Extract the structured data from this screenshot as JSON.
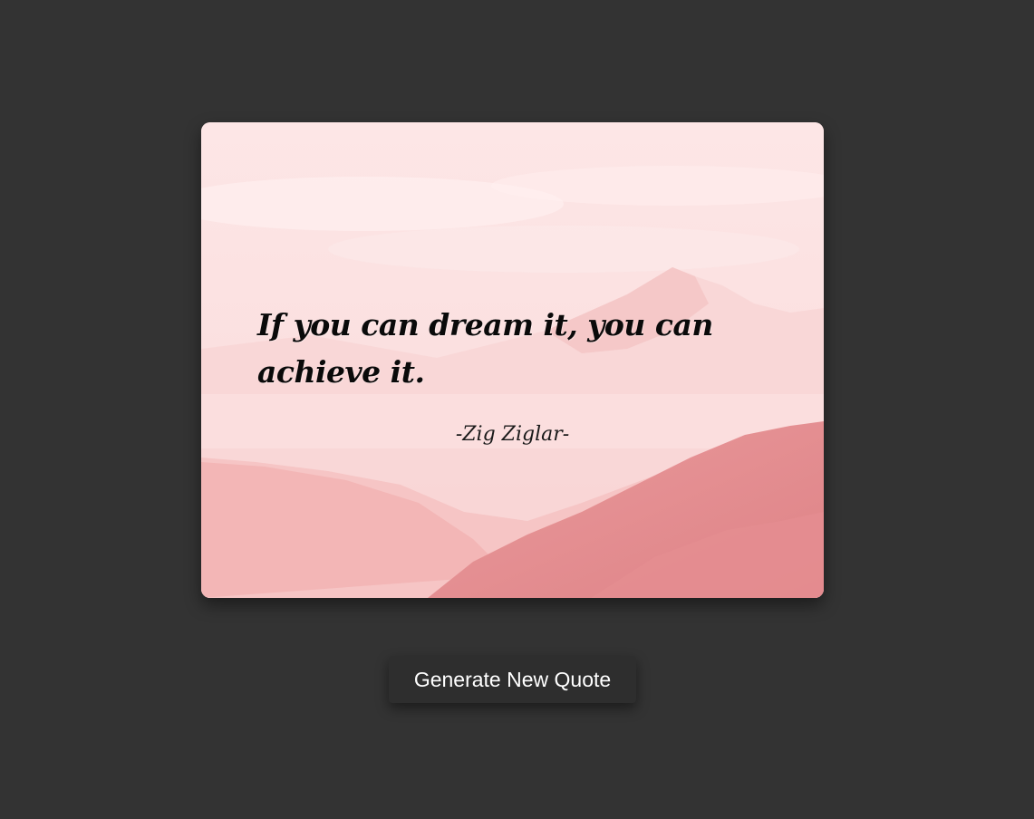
{
  "quote": {
    "text": "If you can dream it, you can achieve it.",
    "author": "-Zig Ziglar-"
  },
  "controls": {
    "generate_label": "Generate New Quote"
  },
  "colors": {
    "page_background": "#333333",
    "card_sky": "#fde3e3",
    "mountain_far": "#f6c9c9",
    "mountain_mid": "#f2b3b3",
    "mountain_near": "#e48b8e",
    "button_background": "#2e2e2e",
    "button_text": "#ffffff"
  }
}
